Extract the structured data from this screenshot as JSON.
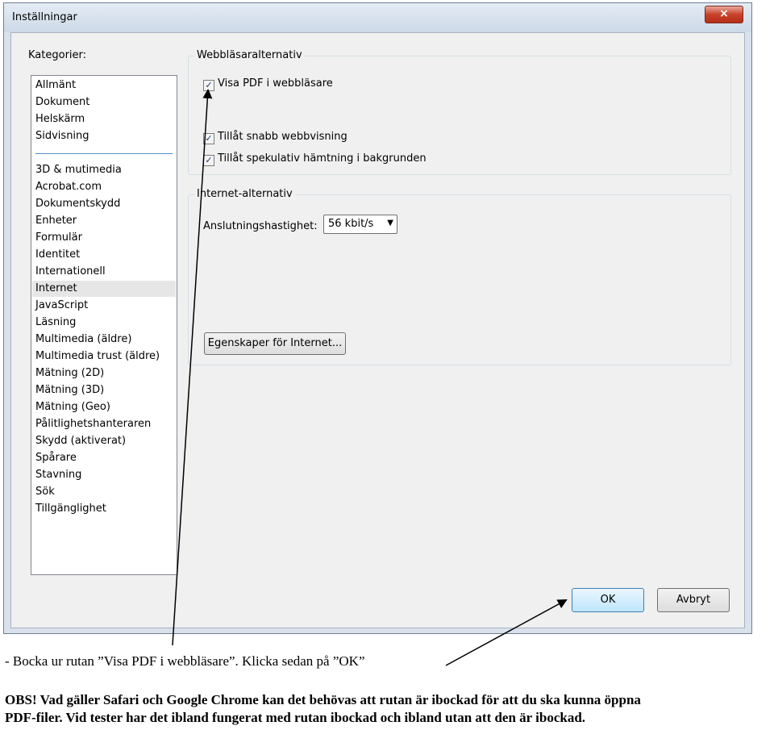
{
  "window": {
    "title": "Inställningar",
    "close_icon": "×"
  },
  "categories": {
    "label": "Kategorier:",
    "group1": [
      "Allmänt",
      "Dokument",
      "Helskärm",
      "Sidvisning"
    ],
    "group2": [
      "3D & mutimedia",
      "Acrobat.com",
      "Dokumentskydd",
      "Enheter",
      "Formulär",
      "Identitet",
      "Internationell",
      "Internet",
      "JavaScript",
      "Läsning",
      "Multimedia (äldre)",
      "Multimedia trust (äldre)",
      "Mätning (2D)",
      "Mätning (3D)",
      "Mätning (Geo)",
      "Pålitlighetshanteraren",
      "Skydd (aktiverat)",
      "Spårare",
      "Stavning",
      "Sök",
      "Tillgänglighet"
    ],
    "selected": "Internet"
  },
  "browser_group": {
    "title": "Webbläsaralternativ",
    "checks": [
      {
        "label": "Visa PDF i webbläsare",
        "checked": true
      },
      {
        "label": "Tillåt snabb webbvisning",
        "checked": true
      },
      {
        "label": "Tillåt spekulativ hämtning i bakgrunden",
        "checked": true
      }
    ]
  },
  "internet_group": {
    "title": "Internet-alternativ",
    "speed_label": "Anslutningshastighet:",
    "speed_value": "56 kbit/s",
    "properties_button": "Egenskaper för Internet..."
  },
  "buttons": {
    "ok": "OK",
    "cancel": "Avbryt"
  },
  "instructions": {
    "line1": "- Bocka ur rutan ”Visa PDF i webbläsare”.  Klicka sedan på ”OK”",
    "note_line1": "OBS! Vad gäller Safari och Google Chrome kan det behövas att rutan är ibockad för att du ska kunna öppna",
    "note_line2": "PDF-filer. Vid tester har det ibland fungerat med rutan ibockad och ibland utan att den är ibockad."
  }
}
